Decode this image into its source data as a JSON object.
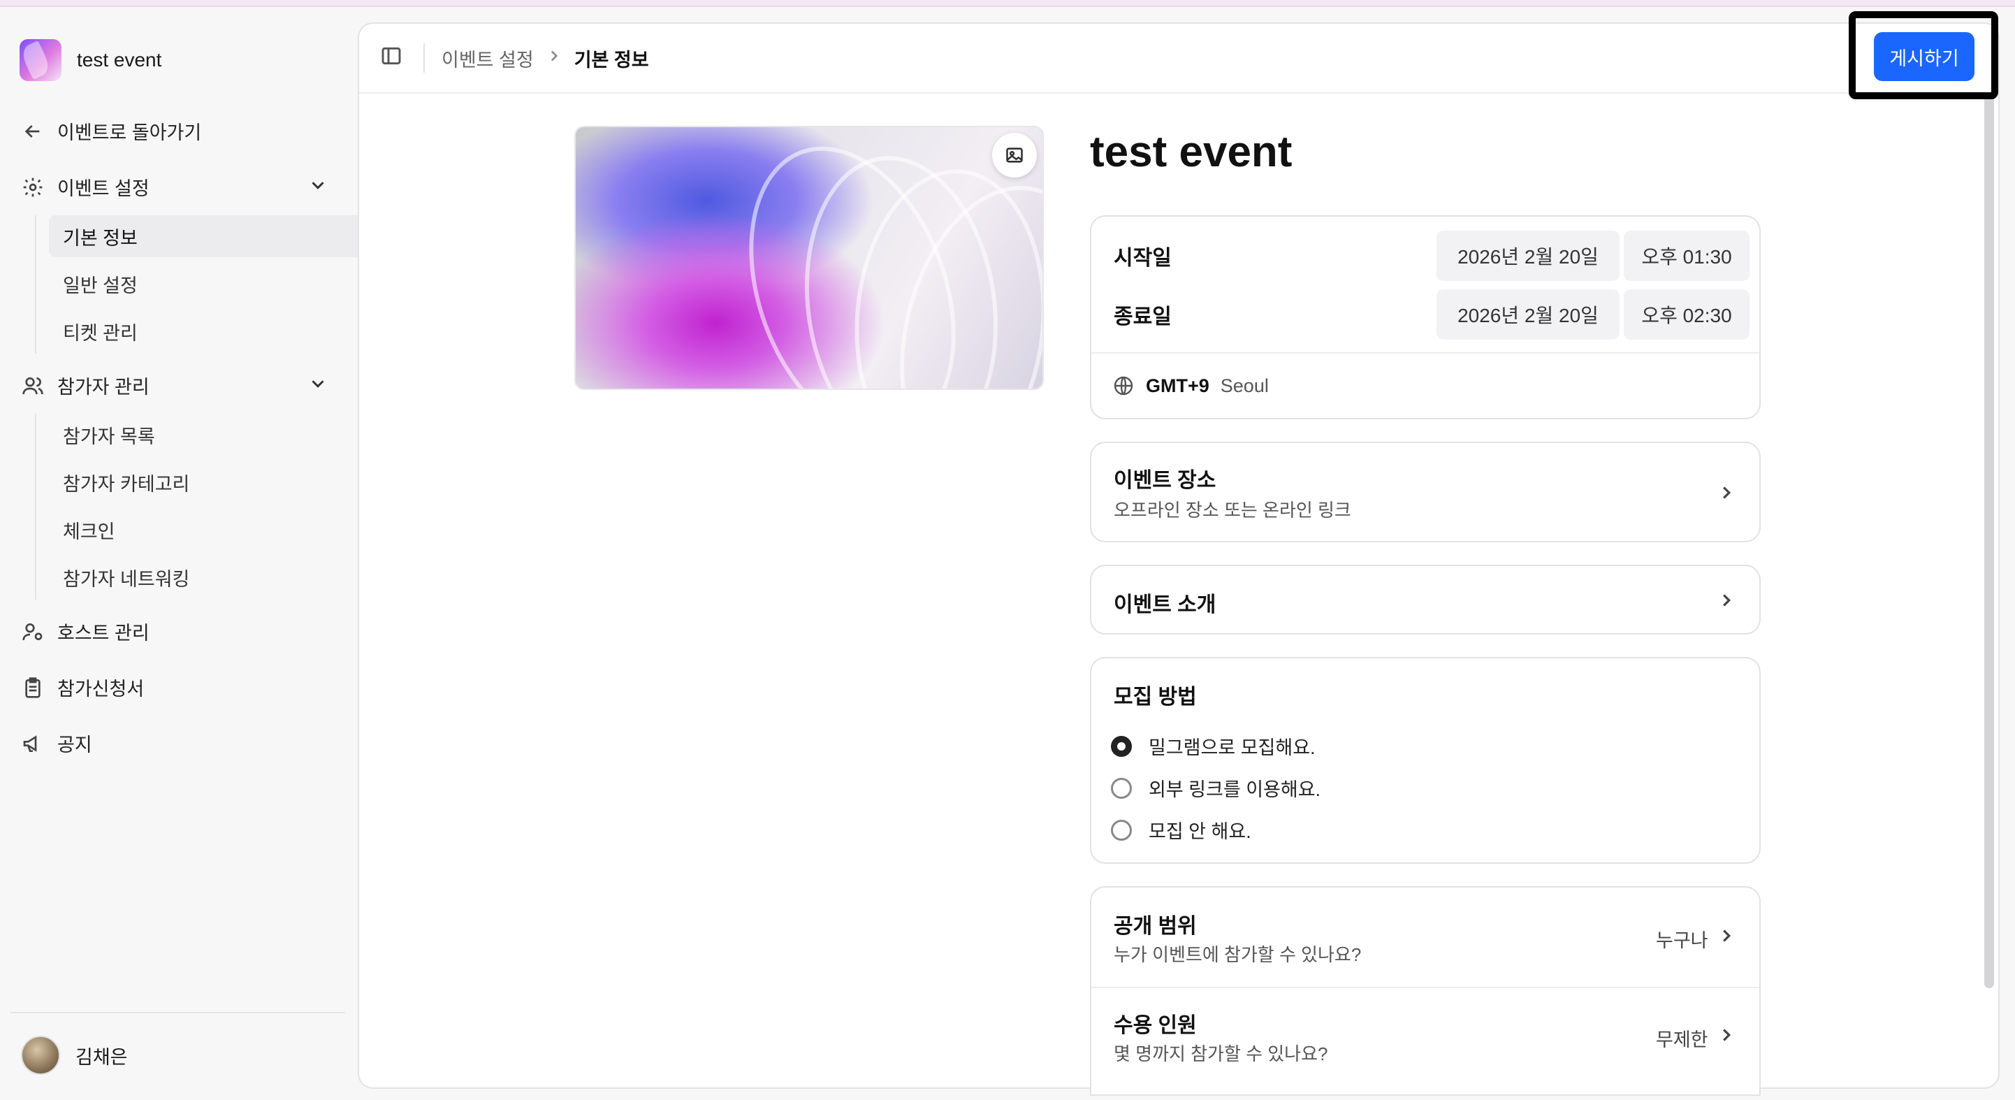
{
  "sidebar": {
    "event_name": "test event",
    "back_label": "이벤트로 돌아가기",
    "sections": [
      {
        "label": "이벤트 설정",
        "items": [
          "기본 정보",
          "일반 설정",
          "티켓 관리"
        ]
      },
      {
        "label": "참가자 관리",
        "items": [
          "참가자 목록",
          "참가자 카테고리",
          "체크인",
          "참가자 네트워킹"
        ]
      }
    ],
    "host_label": "호스트 관리",
    "form_label": "참가신청서",
    "notice_label": "공지",
    "user_name": "김채은"
  },
  "header": {
    "breadcrumb_parent": "이벤트 설정",
    "breadcrumb_current": "기본 정보",
    "publish_label": "게시하기"
  },
  "event": {
    "title": "test event",
    "start_label": "시작일",
    "start_date": "2026년 2월 20일",
    "start_time": "오후 01:30",
    "end_label": "종료일",
    "end_date": "2026년 2월 20일",
    "end_time": "오후 02:30",
    "timezone_offset": "GMT+9",
    "timezone_city": "Seoul",
    "location_label": "이벤트 장소",
    "location_sub": "오프라인 장소 또는 온라인 링크",
    "intro_label": "이벤트 소개",
    "recruit_label": "모집 방법",
    "recruit_options": [
      "밀그램으로 모집해요.",
      "외부 링크를 이용해요.",
      "모집 안 해요."
    ],
    "visibility_label": "공개 범위",
    "visibility_sub": "누가 이벤트에 참가할 수 있나요?",
    "visibility_value": "누구나",
    "capacity_label": "수용 인원",
    "capacity_sub": "몇 명까지 참가할 수 있나요?",
    "capacity_value": "무제한"
  },
  "colors": {
    "accent": "#1a66ff",
    "highlight_border": "#000000"
  }
}
